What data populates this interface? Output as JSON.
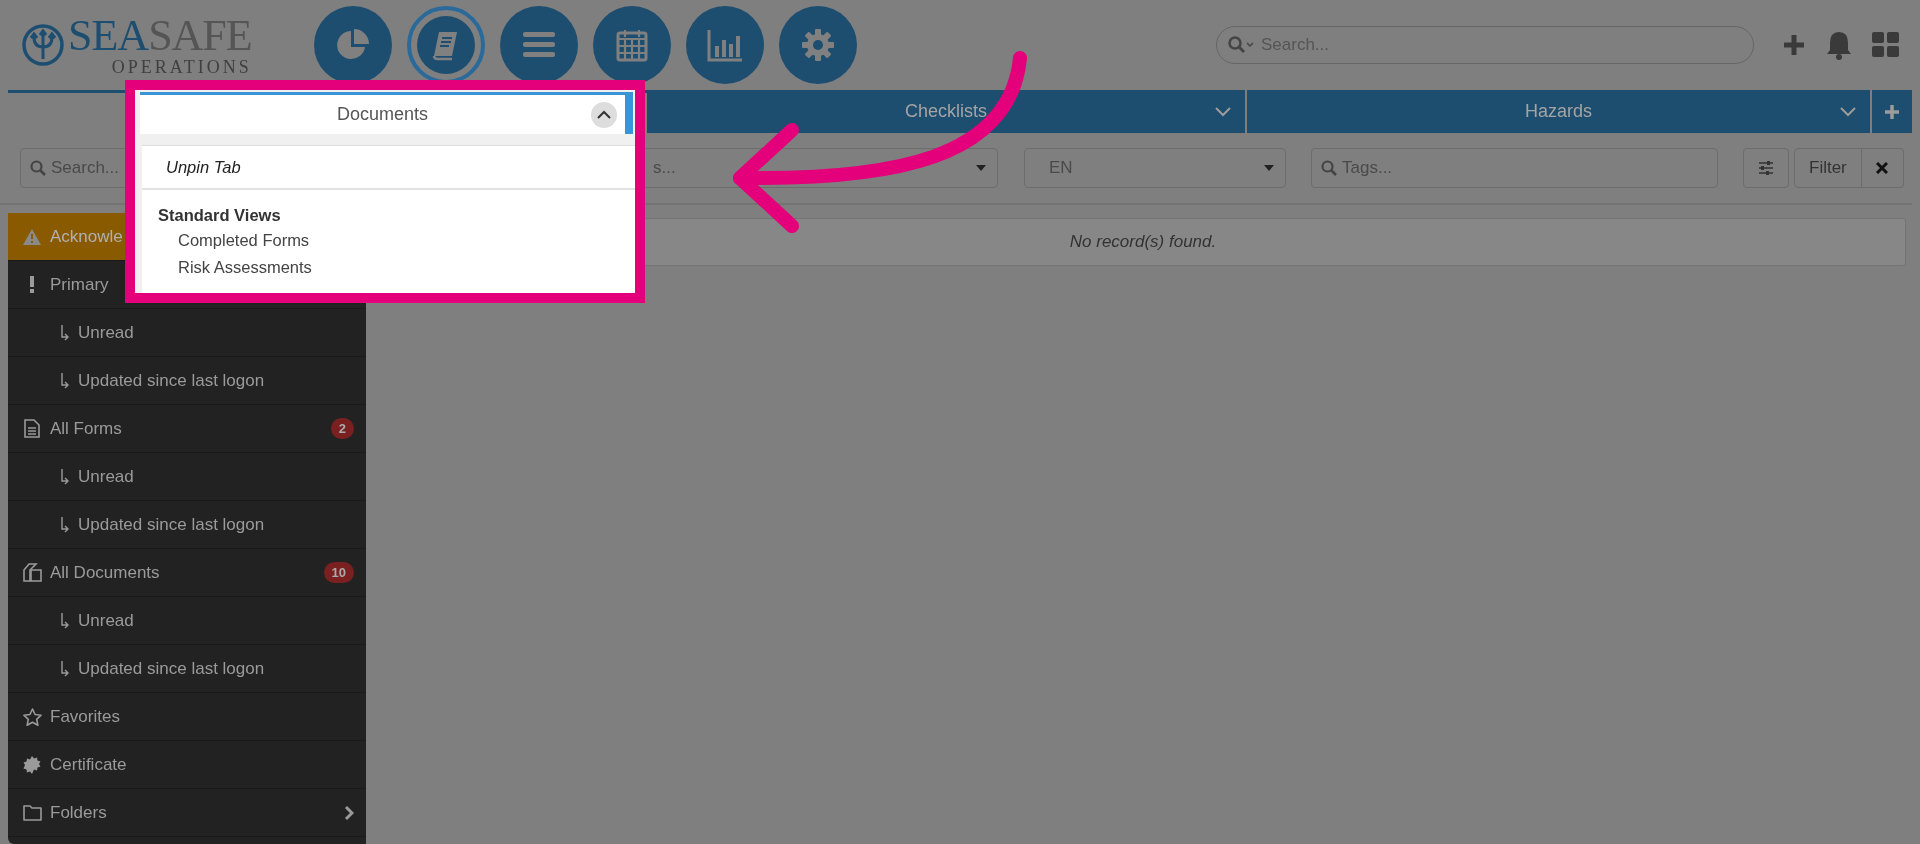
{
  "header": {
    "logo": {
      "brand_primary": "SEA",
      "brand_secondary": "SAFE",
      "tagline": "OPERATIONS"
    },
    "nav_buttons": [
      {
        "kind": "pie",
        "selected": false
      },
      {
        "kind": "book",
        "selected": true
      },
      {
        "kind": "list",
        "selected": false
      },
      {
        "kind": "calendar",
        "selected": false
      },
      {
        "kind": "chart",
        "selected": false
      },
      {
        "kind": "gear",
        "selected": false
      }
    ],
    "search": {
      "placeholder": "Search..."
    }
  },
  "tabs": [
    {
      "label": "Documents",
      "selected": true
    },
    {
      "label": "Checklists",
      "selected": false
    },
    {
      "label": "Hazards",
      "selected": false
    }
  ],
  "tab_menu": {
    "unpin": "Unpin Tab",
    "section": "Standard Views",
    "items": [
      "Completed Forms",
      "Risk Assessments"
    ]
  },
  "filters": {
    "search": {
      "placeholder": "Search..."
    },
    "type_select": {
      "placeholder": "s..."
    },
    "language_select": {
      "value": "EN"
    },
    "tags": {
      "placeholder": "Tags..."
    },
    "filter_button": "Filter"
  },
  "sidebar": {
    "items": [
      {
        "label": "Acknowle",
        "kind": "warning",
        "selected": true
      },
      {
        "label": "Primary",
        "kind": "exclamation",
        "selected": false,
        "children": [
          {
            "label": "Unread",
            "selected": false
          },
          {
            "label": "Updated since last logon",
            "selected": false
          }
        ]
      },
      {
        "label": "All Forms",
        "kind": "file",
        "selected": false,
        "badge": "2",
        "children": [
          {
            "label": "Unread",
            "selected": false
          },
          {
            "label": "Updated since last logon",
            "selected": false
          }
        ]
      },
      {
        "label": "All Documents",
        "kind": "documents",
        "selected": false,
        "badge": "10",
        "children": [
          {
            "label": "Unread",
            "selected": false
          },
          {
            "label": "Updated since last logon",
            "selected": false
          }
        ]
      },
      {
        "label": "Favorites",
        "kind": "star",
        "selected": false
      },
      {
        "label": "Certificate",
        "kind": "certificate",
        "selected": false
      },
      {
        "label": "Folders",
        "kind": "folder",
        "selected": false,
        "expandable": true
      }
    ]
  },
  "content": {
    "message": "No record(s) found."
  }
}
